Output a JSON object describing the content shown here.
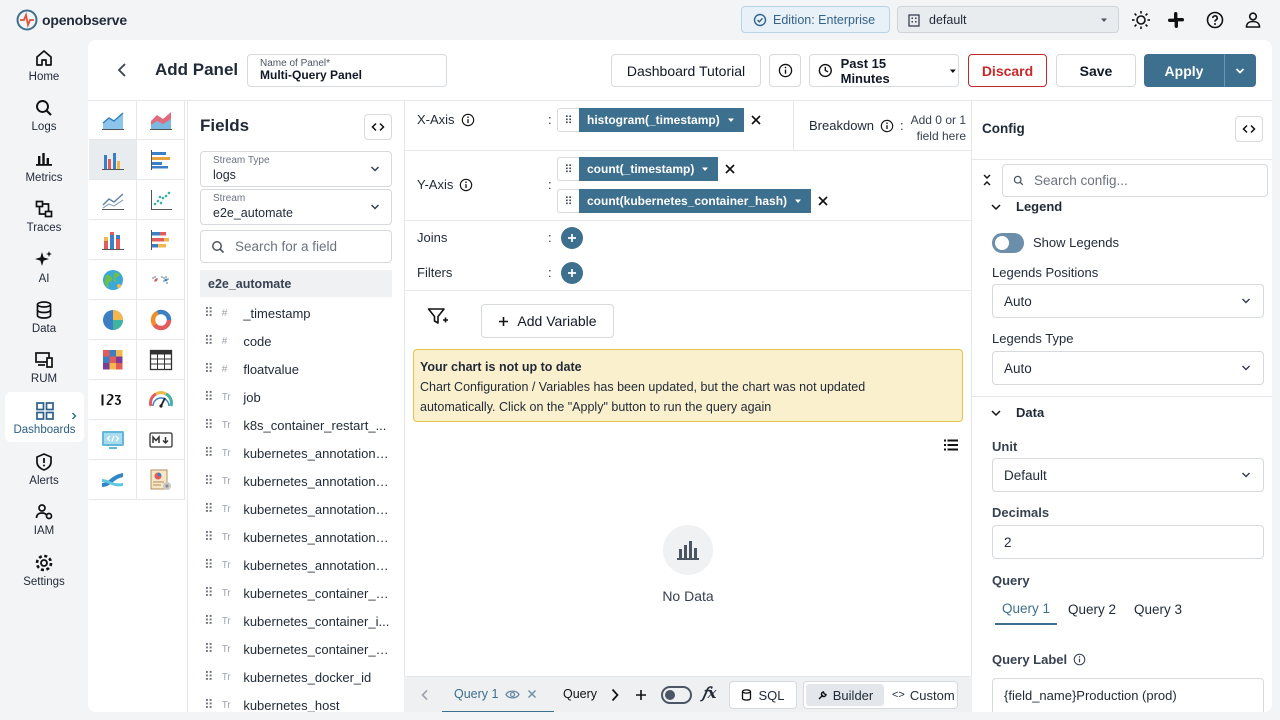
{
  "app": {
    "logo_text": "openobserve"
  },
  "topbar": {
    "edition": "Edition: Enterprise",
    "org": "default"
  },
  "nav": [
    {
      "label": "Home",
      "icon": "home-icon"
    },
    {
      "label": "Logs",
      "icon": "search-icon"
    },
    {
      "label": "Metrics",
      "icon": "bar-chart-icon"
    },
    {
      "label": "Traces",
      "icon": "traces-icon"
    },
    {
      "label": "AI",
      "icon": "sparkle-icon"
    },
    {
      "label": "Data",
      "icon": "database-icon"
    },
    {
      "label": "RUM",
      "icon": "devices-icon"
    },
    {
      "label": "Dashboards",
      "icon": "dashboard-icon",
      "active": true
    },
    {
      "label": "Alerts",
      "icon": "alert-icon"
    },
    {
      "label": "IAM",
      "icon": "users-icon"
    },
    {
      "label": "Settings",
      "icon": "gear-icon"
    }
  ],
  "header": {
    "title": "Add Panel",
    "panel_name_label": "Name of Panel*",
    "panel_name_value": "Multi-Query Panel",
    "tutorial": "Dashboard Tutorial",
    "time_range": "Past 15 Minutes",
    "discard": "Discard",
    "save": "Save",
    "apply": "Apply"
  },
  "fields": {
    "title": "Fields",
    "stream_type_label": "Stream Type",
    "stream_type_value": "logs",
    "stream_label": "Stream",
    "stream_value": "e2e_automate",
    "search_placeholder": "Search for a field",
    "group": "e2e_automate",
    "items": [
      {
        "type": "#",
        "name": "_timestamp"
      },
      {
        "type": "#",
        "name": "code"
      },
      {
        "type": "#",
        "name": "floatvalue"
      },
      {
        "type": "Tr",
        "name": "job"
      },
      {
        "type": "Tr",
        "name": "k8s_container_restart_..."
      },
      {
        "type": "Tr",
        "name": "kubernetes_annotations..."
      },
      {
        "type": "Tr",
        "name": "kubernetes_annotations..."
      },
      {
        "type": "Tr",
        "name": "kubernetes_annotations..."
      },
      {
        "type": "Tr",
        "name": "kubernetes_annotations..."
      },
      {
        "type": "Tr",
        "name": "kubernetes_annotations..."
      },
      {
        "type": "Tr",
        "name": "kubernetes_container_h..."
      },
      {
        "type": "Tr",
        "name": "kubernetes_container_i..."
      },
      {
        "type": "Tr",
        "name": "kubernetes_container_n..."
      },
      {
        "type": "Tr",
        "name": "kubernetes_docker_id"
      },
      {
        "type": "Tr",
        "name": "kubernetes_host"
      }
    ]
  },
  "query_builder": {
    "x_axis_label": "X-Axis",
    "x_axis_field": "histogram(_timestamp)",
    "breakdown_label": "Breakdown",
    "breakdown_hint_1": "Add 0 or 1",
    "breakdown_hint_2": "field here",
    "y_axis_label": "Y-Axis",
    "y_axis_fields": [
      "count(_timestamp)",
      "count(kubernetes_container_hash)"
    ],
    "joins_label": "Joins",
    "filters_label": "Filters",
    "add_variable": "Add Variable",
    "warning_title": "Your chart is not up to date",
    "warning_line1": "Chart Configuration / Variables has been updated, but the chart was not updated",
    "warning_line2": "automatically. Click on the \"Apply\" button to run the query again",
    "no_data": "No Data"
  },
  "query_bar": {
    "tab1": "Query 1",
    "tab2": "Query",
    "sql": "SQL",
    "builder": "Builder",
    "custom": "Custom"
  },
  "config": {
    "title": "Config",
    "search_placeholder": "Search config...",
    "legend_section": "Legend",
    "show_legends": "Show Legends",
    "legends_position_label": "Legends Positions",
    "legends_position_value": "Auto",
    "legends_type_label": "Legends Type",
    "legends_type_value": "Auto",
    "data_section": "Data",
    "unit_label": "Unit",
    "unit_value": "Default",
    "decimals_label": "Decimals",
    "decimals_value": "2",
    "query_label": "Query",
    "query_tabs": [
      "Query 1",
      "Query 2",
      "Query 3"
    ],
    "query_label_label": "Query Label",
    "query_label_value": "{field_name}Production (prod)"
  },
  "colors": {
    "accent": "#3d6f8f",
    "discard": "#c62828",
    "warning_bg": "#fbf0cd"
  }
}
